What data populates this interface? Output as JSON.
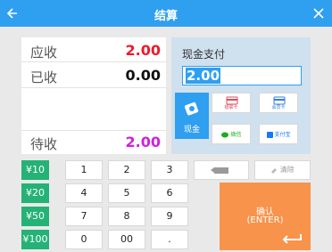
{
  "header": {
    "title": "结算",
    "back_icon": "back-arrow-icon",
    "close_icon": "close-icon",
    "color": "#2f9ff0"
  },
  "amounts": {
    "due_label": "应收",
    "due_value": "2.00",
    "received_label": "已收",
    "received_value": "0.00",
    "pending_label": "待收",
    "pending_value": "2.00"
  },
  "payment": {
    "title": "现金支付",
    "input_value": "2.00",
    "cash_label": "现金",
    "methods": {
      "bank_card": "银联卡",
      "member_card": "会员卡",
      "wechat": "微信",
      "alipay": "支付宝"
    }
  },
  "keypad": {
    "quick": [
      "¥10",
      "¥20",
      "¥50",
      "¥100"
    ],
    "rows": [
      [
        "1",
        "2",
        "3"
      ],
      [
        "4",
        "5",
        "6"
      ],
      [
        "7",
        "8",
        "9"
      ],
      [
        "0",
        "00",
        "."
      ]
    ],
    "clear_label": "清除",
    "confirm_line1": "确认",
    "confirm_line2": "(ENTER)"
  },
  "colors": {
    "accent": "#2f9ff0",
    "quick": "#25b277",
    "confirm": "#f7934a",
    "due": "#f0182a",
    "pending": "#d020e0"
  }
}
